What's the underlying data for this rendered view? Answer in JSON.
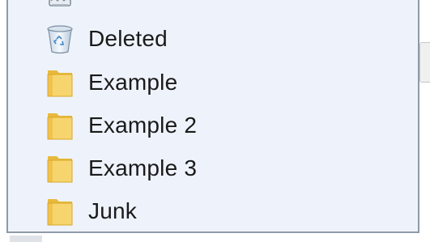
{
  "folders": {
    "items": [
      {
        "label": "",
        "icon": "mail-tray-icon"
      },
      {
        "label": "Deleted",
        "icon": "recycle-bin-icon"
      },
      {
        "label": "Example",
        "icon": "folder-icon"
      },
      {
        "label": "Example 2",
        "icon": "folder-icon"
      },
      {
        "label": "Example 3",
        "icon": "folder-icon"
      },
      {
        "label": "Junk",
        "icon": "folder-icon"
      }
    ]
  },
  "colors": {
    "pane_background": "#eef3fb",
    "pane_border": "#8e9aa7",
    "folder_yellow": "#f5d36a",
    "text": "#1a1a1a"
  }
}
